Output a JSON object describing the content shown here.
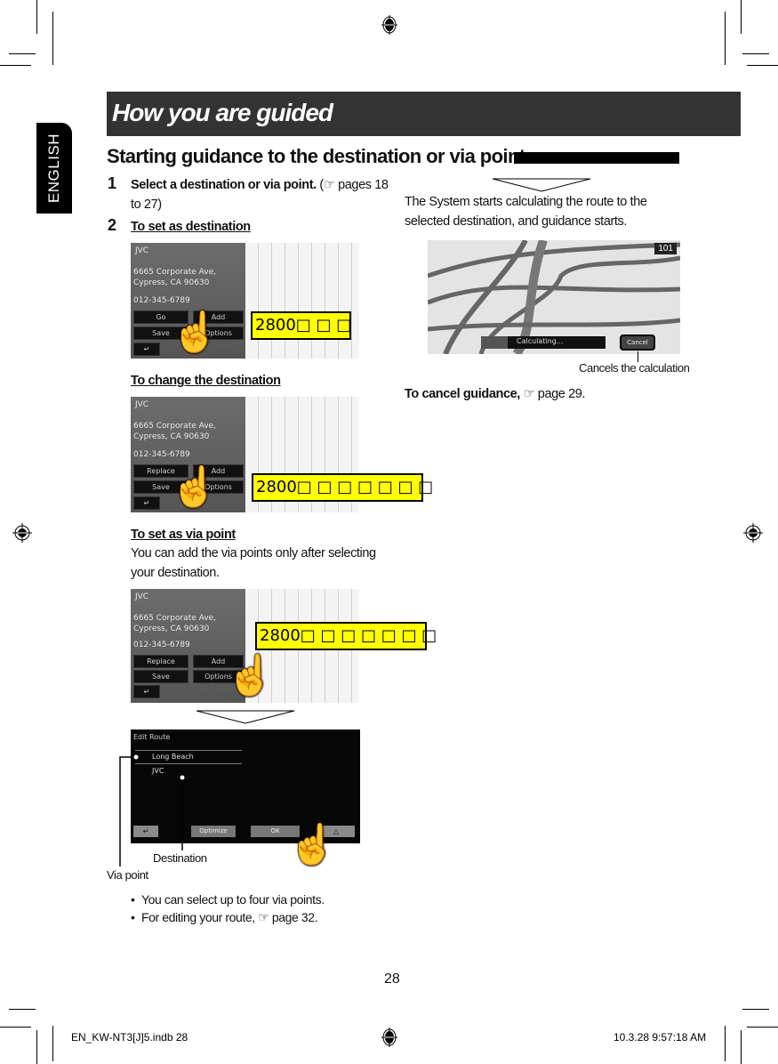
{
  "language_tab": "ENGLISH",
  "page_title": "How you are guided",
  "section_title": "Starting guidance to the destination or via point",
  "steps": [
    {
      "number": "1",
      "text_bold": "Select a destination or via point.",
      "text_ref": "(☞ pages 18 to 27)"
    },
    {
      "number": "2",
      "text_heading": "To set as destination"
    }
  ],
  "subsections": {
    "change_destination": "To change the destination",
    "set_via_point": "To set as via point",
    "via_point_note": "You can add the via points only after selecting your destination."
  },
  "screen_panel": {
    "name": "JVC",
    "address_line1": "6665 Corporate Ave,",
    "address_line2": "Cypress, CA 90630",
    "phone": "012-345-6789",
    "buttons": {
      "go": "Go",
      "add": "Add",
      "replace": "Replace",
      "save": "Save",
      "options": "Options"
    }
  },
  "placeholder_labels": {
    "label_1": "2800□ □ □",
    "label_2": "2800□ □ □ □ □ □ □",
    "label_3": "2800□ □ □ □ □ □ □"
  },
  "edit_route_screen": {
    "title": "Edit Route",
    "items": [
      "Long Beach",
      "JVC"
    ],
    "buttons": {
      "optimize": "Optimize",
      "ok": "OK"
    }
  },
  "callouts": {
    "via_point": "Via point",
    "destination": "Destination",
    "cancels": "Cancels the calculation"
  },
  "bullets": [
    "You can select up to four via points.",
    "For editing your route, ☞ page 32."
  ],
  "right_column": {
    "calc_text": "The System starts calculating the route to the selected destination, and guidance starts.",
    "calc_screen": {
      "status": "Calculating...",
      "cancel": "Cancel",
      "route_badge": "101"
    },
    "cancel_guidance_bold": "To cancel guidance,",
    "cancel_guidance_ref": "☞ page 29."
  },
  "page_number": "28",
  "slug": {
    "file": "EN_KW-NT3[J]5.indb   28",
    "timestamp": "10.3.28   9:57:18 AM"
  }
}
